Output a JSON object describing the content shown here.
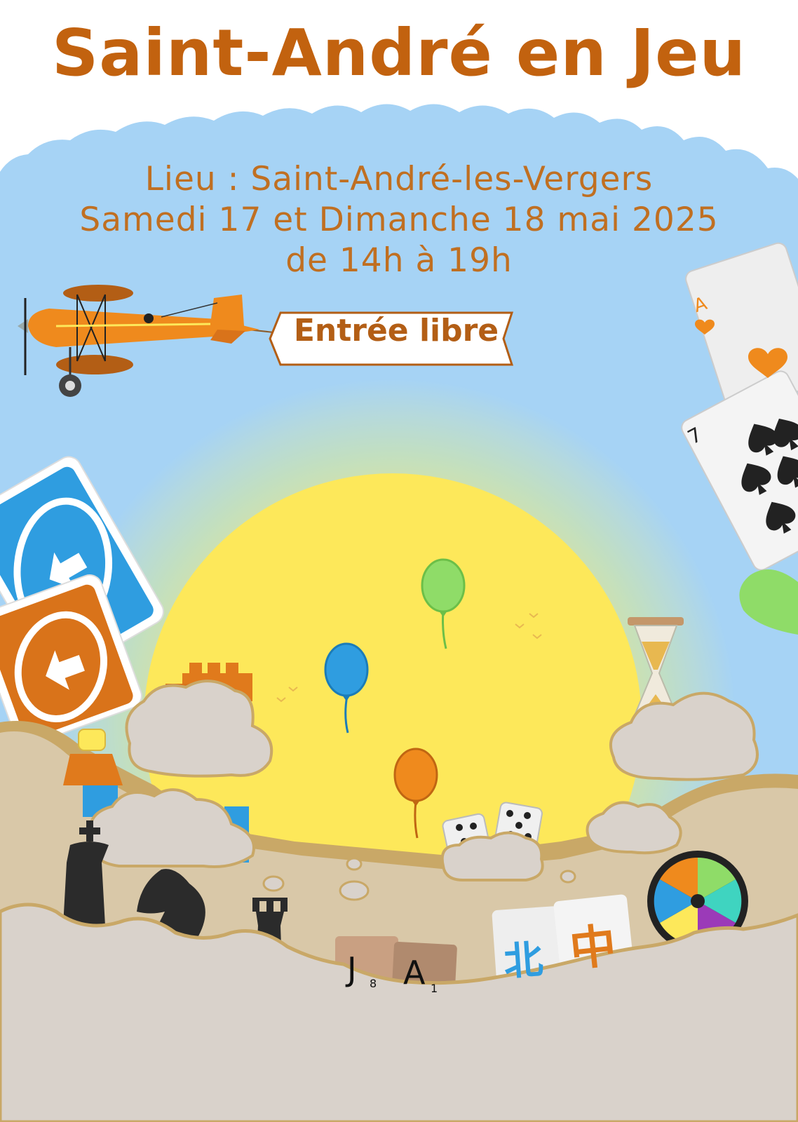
{
  "poster": {
    "title": "Saint-André en Jeu",
    "location_line": "Lieu : Saint-André-les-Vergers",
    "dates_line": "Samedi 17 et Dimanche 18 mai 2025",
    "hours_line": "de 14h à 19h",
    "banner": "Entrée libre"
  },
  "game_pieces": {
    "scrabble_tiles": [
      {
        "letter": "J",
        "score": "8"
      },
      {
        "letter": "A",
        "score": "1"
      }
    ],
    "mahjong_tiles": [
      "北",
      "中"
    ],
    "cards": [
      {
        "rank": "A",
        "suit": "heart"
      },
      {
        "rank": "7",
        "suit": "spade"
      }
    ]
  },
  "colors": {
    "title": "#c2620f",
    "sky": "#a6d3f5",
    "sun": "#fde85a",
    "cloud": "#d9d2cb",
    "cloud_edge": "#c9a867",
    "plane": "#ef8a1d",
    "balloon_blue": "#2f9de0",
    "balloon_green": "#8fdc68",
    "balloon_orange": "#ef8a1d"
  }
}
